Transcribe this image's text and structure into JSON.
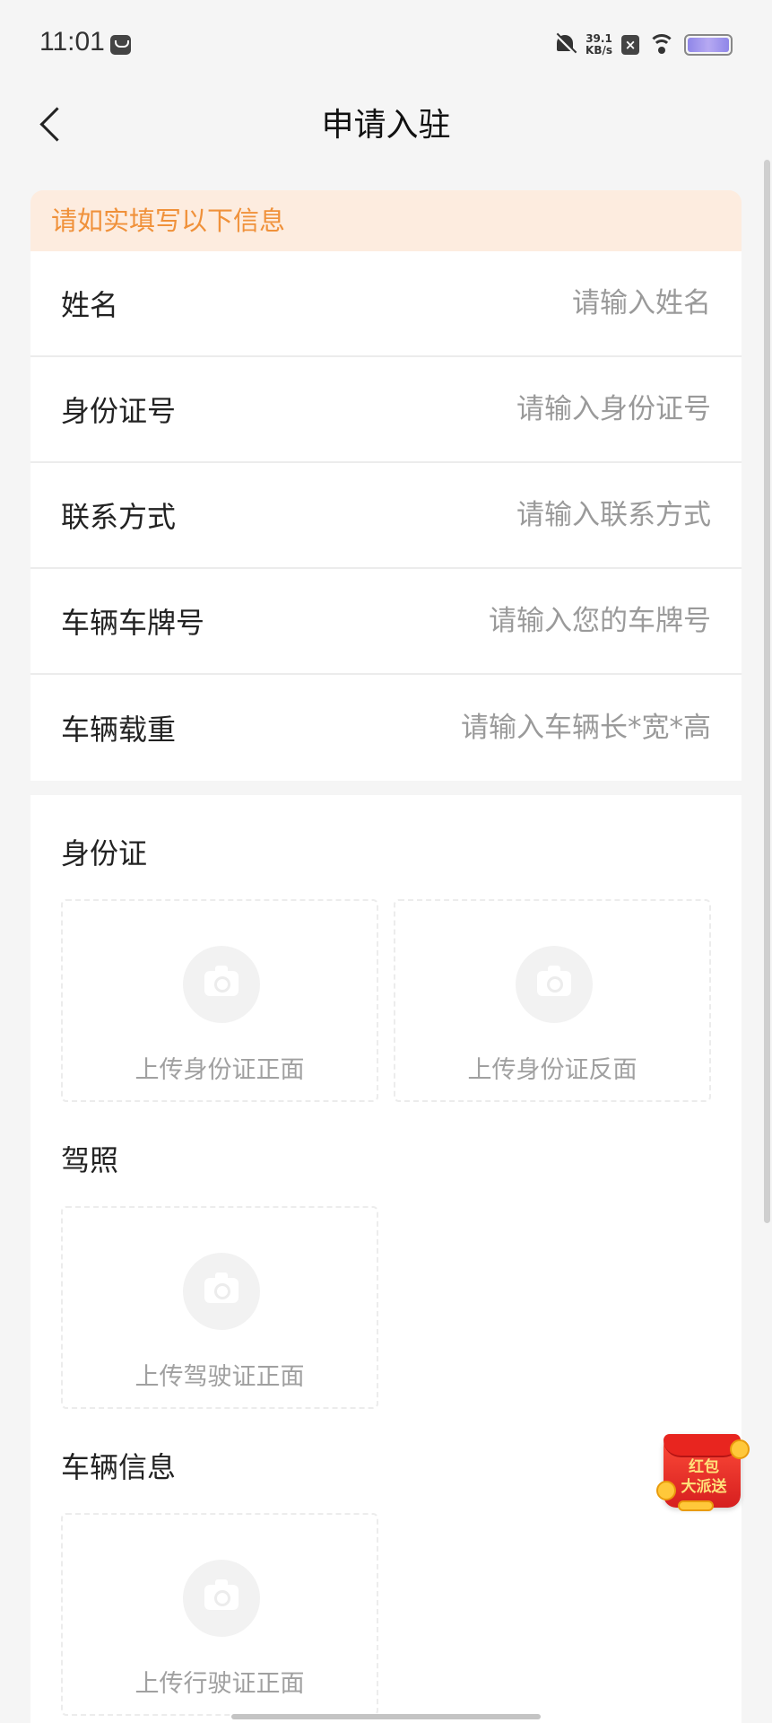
{
  "status_bar": {
    "time": "11:01",
    "net_speed_value": "39.1",
    "net_speed_unit": "KB/s",
    "battery_color": "#9b8ff0"
  },
  "header": {
    "title": "申请入驻"
  },
  "form": {
    "notice": "请如实填写以下信息",
    "notice_color": "#f0913a",
    "fields": [
      {
        "label": "姓名",
        "placeholder": "请输入姓名",
        "value": ""
      },
      {
        "label": "身份证号",
        "placeholder": "请输入身份证号",
        "value": ""
      },
      {
        "label": "联系方式",
        "placeholder": "请输入联系方式",
        "value": ""
      },
      {
        "label": "车辆车牌号",
        "placeholder": "请输入您的车牌号",
        "value": ""
      },
      {
        "label": "车辆载重",
        "placeholder": "请输入车辆长*宽*高",
        "value": ""
      }
    ]
  },
  "uploads": {
    "sections": [
      {
        "title": "身份证",
        "boxes": [
          "上传身份证正面",
          "上传身份证反面"
        ]
      },
      {
        "title": "驾照",
        "boxes": [
          "上传驾驶证正面"
        ]
      },
      {
        "title": "车辆信息",
        "boxes": [
          "上传行驶证正面"
        ]
      }
    ],
    "icon": "camera-icon"
  },
  "promo": {
    "line1": "红包",
    "line2": "大派送"
  }
}
